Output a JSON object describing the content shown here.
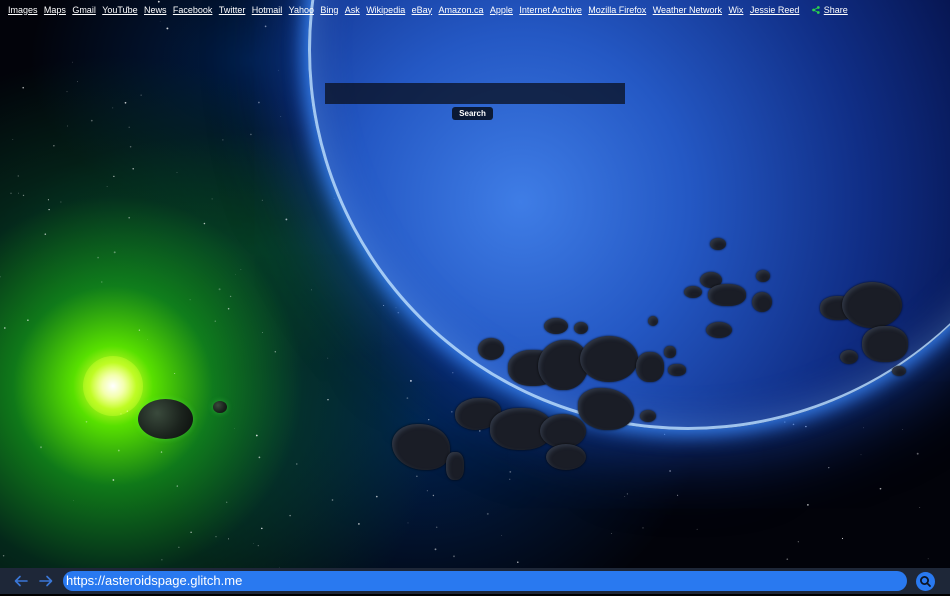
{
  "links": [
    {
      "label": "Images"
    },
    {
      "label": "Maps"
    },
    {
      "label": "Gmail"
    },
    {
      "label": "YouTube"
    },
    {
      "label": "News"
    },
    {
      "label": "Facebook"
    },
    {
      "label": "Twitter"
    },
    {
      "label": "Hotmail"
    },
    {
      "label": "Yahoo"
    },
    {
      "label": "Bing"
    },
    {
      "label": "Ask"
    },
    {
      "label": "Wikipedia"
    },
    {
      "label": "eBay"
    },
    {
      "label": "Amazon.ca"
    },
    {
      "label": "Apple"
    },
    {
      "label": "Internet Archive"
    },
    {
      "label": "Mozilla Firefox"
    },
    {
      "label": "Weather Network"
    },
    {
      "label": "Wix"
    },
    {
      "label": "Jessie Reed"
    }
  ],
  "share": {
    "label": "Share",
    "icon": "share-icon",
    "color": "#2bd54b"
  },
  "search": {
    "value": "",
    "button_label": "Search"
  },
  "browser": {
    "url": "https://asteroidspage.glitch.me",
    "back_icon": "arrow-left-icon",
    "forward_icon": "arrow-right-icon",
    "go_icon": "search-icon",
    "accent": "#2979f0",
    "bar_color": "#1e2738"
  }
}
